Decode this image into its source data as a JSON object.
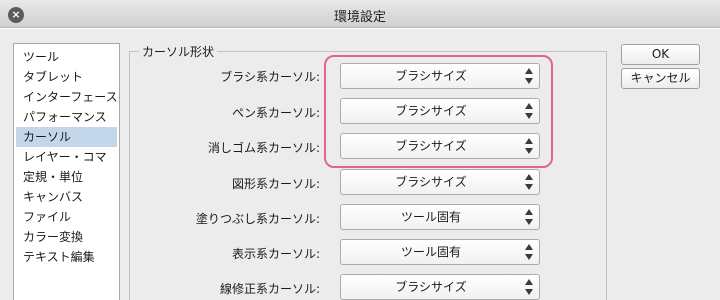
{
  "window": {
    "title": "環境設定"
  },
  "sidebar": {
    "items": [
      {
        "label": "ツール"
      },
      {
        "label": "タブレット"
      },
      {
        "label": "インターフェース"
      },
      {
        "label": "パフォーマンス"
      },
      {
        "label": "カーソル",
        "selected": true
      },
      {
        "label": "レイヤー・コマ"
      },
      {
        "label": "定規・単位"
      },
      {
        "label": "キャンバス"
      },
      {
        "label": "ファイル"
      },
      {
        "label": "カラー変換"
      },
      {
        "label": "テキスト編集"
      }
    ]
  },
  "cursor_group": {
    "legend": "カーソル形状",
    "rows": [
      {
        "label": "ブラシ系カーソル:",
        "value": "ブラシサイズ"
      },
      {
        "label": "ペン系カーソル:",
        "value": "ブラシサイズ"
      },
      {
        "label": "消しゴム系カーソル:",
        "value": "ブラシサイズ"
      },
      {
        "label": "図形系カーソル:",
        "value": "ブラシサイズ"
      },
      {
        "label": "塗りつぶし系カーソル:",
        "value": "ツール固有"
      },
      {
        "label": "表示系カーソル:",
        "value": "ツール固有"
      },
      {
        "label": "線修正系カーソル:",
        "value": "ブラシサイズ"
      }
    ]
  },
  "buttons": {
    "ok": "OK",
    "cancel": "キャンセル"
  },
  "colors": {
    "highlight": "#e2648f",
    "selection": "#c3d6ea"
  }
}
